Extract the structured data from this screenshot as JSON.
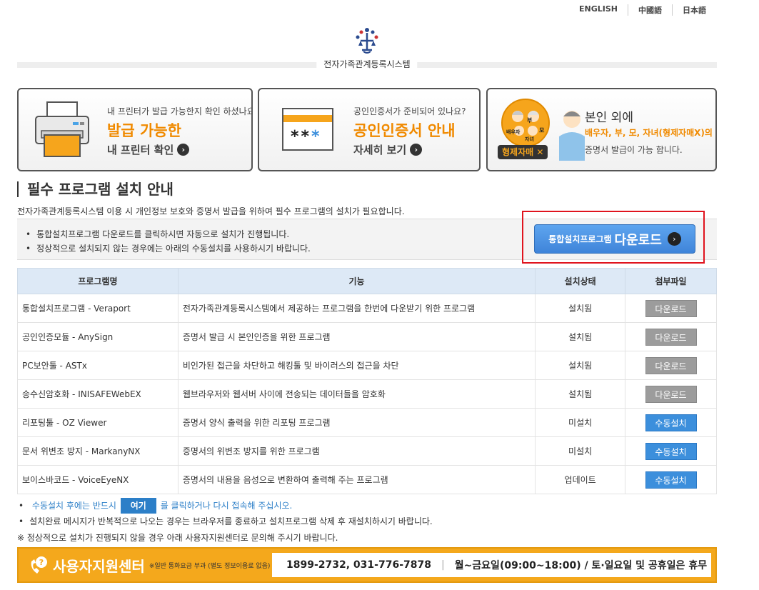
{
  "lang": {
    "english": "ENGLISH",
    "chinese": "中國語",
    "japanese": "日本語"
  },
  "header": {
    "title": "전자가족관계등록시스템"
  },
  "cards": {
    "printer": {
      "question": "내 프린터가 발급 가능한지 확인 하셨나요?",
      "big": "발급 가능한",
      "sub": "내 프린터 확인"
    },
    "cert": {
      "question": "공인인증서가 준비되어 있나요?",
      "big": "공인인증서 안내",
      "sub": "자세히 보기",
      "masked": "**"
    },
    "family": {
      "line1": "본인 외에",
      "line2": "배우자, 부, 모, 자녀(형제자매X)의",
      "line3": "증명서 발급이 가능 합니다.",
      "badge": "형제자매",
      "badge_x": "✕",
      "bubble_spouse": "배우자",
      "bubble_father": "부",
      "bubble_mother": "모",
      "bubble_child": "자녀"
    }
  },
  "section": {
    "title": "필수 프로그램 설치 안내",
    "desc": "전자가족관계등록시스템 이용 시 개인정보 보호와 증명서 발급을 위하여 필수 프로그램의 설치가 필요합니다."
  },
  "notice": {
    "items": [
      "통합설치프로그램 다운로드를 클릭하시면 자동으로 설치가 진행됩니다.",
      "정상적으로 설치되지 않는 경우에는 아래의 수동설치를 사용하시기 바랍니다."
    ]
  },
  "download_button": {
    "small": "통합설치프로그램",
    "large": "다운로드"
  },
  "table": {
    "headers": {
      "name": "프로그램명",
      "function": "기능",
      "status": "설치상태",
      "file": "첨부파일"
    },
    "rows": [
      {
        "name": "통합설치프로그램 - Veraport",
        "function": "전자가족관계등록시스템에서 제공하는 프로그램을 한번에 다운받기 위한 프로그램",
        "status": "설치됨",
        "button": "다운로드"
      },
      {
        "name": "공인인증모듈 - AnySign",
        "function": "증명서 발급 시 본인인증을 위한 프로그램",
        "status": "설치됨",
        "button": "다운로드"
      },
      {
        "name": "PC보안툴 - ASTx",
        "function": "비인가된 접근을 차단하고 해킹툴 및 바이러스의 접근을 차단",
        "status": "설치됨",
        "button": "다운로드"
      },
      {
        "name": "송수신암호화 - INISAFEWebEX",
        "function": "웹브라우저와 웹서버 사이에 전송되는 데이터들을 암호화",
        "status": "설치됨",
        "button": "다운로드"
      },
      {
        "name": "리포팅툴 - OZ Viewer",
        "function": "증명서 양식 출력을 위한 리포팅 프로그램",
        "status": "미설치",
        "button": "수동설치"
      },
      {
        "name": "문서 위변조 방지 - MarkanyNX",
        "function": "증명서의 위변조 방지를 위한 프로그램",
        "status": "미설치",
        "button": "수동설치"
      },
      {
        "name": "보이스바코드 - VoiceEyeNX",
        "function": "증명서의 내용을 음성으로 변환하여 출력해 주는 프로그램",
        "status": "업데이트",
        "button": "수동설치"
      }
    ]
  },
  "after": {
    "line1_before": "수동설치 후에는 반드시",
    "line1_link": "여기",
    "line1_after": "를 클릭하거나 다시 접속해 주십시오.",
    "line2": "설치완료 메시지가 반복적으로 나오는 경우는 브라우저를 종료하고 설치프로그램 삭제 후 재설치하시기 바랍니다.",
    "warn": "※ 정상적으로 설치가 진행되지 않을 경우 아래 사용자지원센터로 문의해 주시기 바랍니다."
  },
  "support": {
    "title": "사용자지원센터",
    "note": "※일반 통화요금 부과 (별도 정보이용료 없음)",
    "phones": "1899-2732, 031-776-7878",
    "sep": "|",
    "hours": "월~금요일(09:00~18:00) / 토·일요일 및 공휴일은 휴무"
  }
}
